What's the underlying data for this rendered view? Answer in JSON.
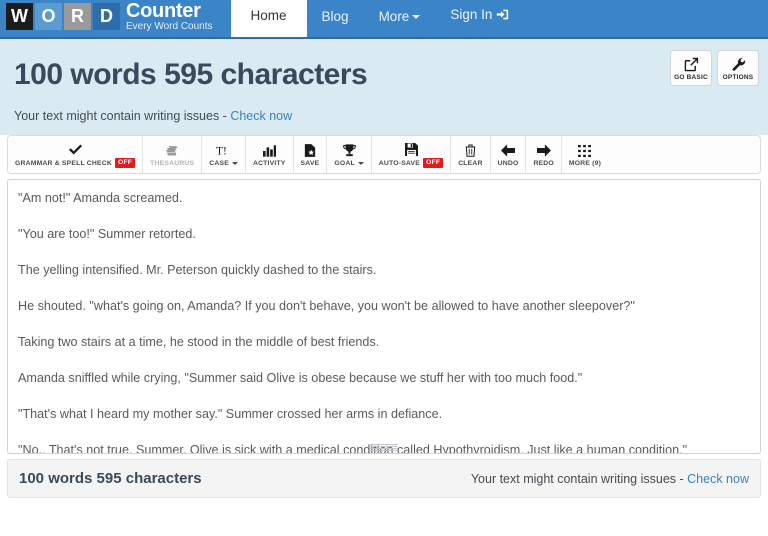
{
  "navbar": {
    "logo_letters": [
      "W",
      "O",
      "R",
      "D"
    ],
    "brand_title": "Counter",
    "brand_tagline": "Every Word Counts",
    "items": [
      {
        "label": "Home",
        "active": true
      },
      {
        "label": "Blog",
        "active": false
      },
      {
        "label": "More",
        "active": false,
        "caret": true
      },
      {
        "label": "Sign In",
        "active": false,
        "icon": "sign-in-icon"
      }
    ],
    "colors": {
      "bar": "#3b84c8",
      "bar_border": "#2f6da8"
    }
  },
  "banner": {
    "title": "100 words 595 characters",
    "notice_text": "Your text might contain writing issues - ",
    "notice_link": "Check now",
    "background": "#d9eaf2",
    "title_color": "#3a4a5c",
    "link_color": "#3a82c4",
    "actions": [
      {
        "label": "GO BASIC",
        "icon": "external-link-icon"
      },
      {
        "label": "OPTIONS",
        "icon": "wrench-icon"
      }
    ]
  },
  "toolbar": {
    "buttons": [
      {
        "label": "GRAMMAR & SPELL CHECK",
        "icon": "check-icon",
        "badge": "OFF",
        "caret": false,
        "muted": false
      },
      {
        "label": "THESAURUS",
        "icon": "book-icon",
        "badge": "",
        "caret": false,
        "muted": true
      },
      {
        "label": "CASE",
        "icon": "text-case-icon",
        "badge": "",
        "caret": true,
        "muted": false
      },
      {
        "label": "ACTIVITY",
        "icon": "bar-chart-icon",
        "badge": "",
        "caret": false,
        "muted": false
      },
      {
        "label": "SAVE",
        "icon": "save-document-icon",
        "badge": "",
        "caret": false,
        "muted": false
      },
      {
        "label": "GOAL",
        "icon": "trophy-icon",
        "badge": "",
        "caret": true,
        "muted": false
      },
      {
        "label": "AUTO-SAVE",
        "icon": "floppy-disk-icon",
        "badge": "OFF",
        "caret": false,
        "muted": false
      },
      {
        "label": "CLEAR",
        "icon": "trash-icon",
        "badge": "",
        "caret": false,
        "muted": false
      },
      {
        "label": "UNDO",
        "icon": "arrow-left-icon",
        "badge": "",
        "caret": false,
        "muted": false
      },
      {
        "label": "REDO",
        "icon": "arrow-right-icon",
        "badge": "",
        "caret": false,
        "muted": false
      },
      {
        "label": "MORE (9)",
        "icon": "grid-icon",
        "badge": "",
        "caret": false,
        "muted": false
      }
    ],
    "badge_color": "#e21b1b"
  },
  "editor": {
    "paragraphs": [
      "\"Am not!\" Amanda screamed.",
      "\"You are too!\" Summer retorted.",
      "The yelling intensified. Mr. Peterson quickly dashed to the stairs.",
      "He shouted. \"what's going on, Amanda? If you don't behave, you won't be allowed to have another sleepover?\"",
      "Taking two stairs at a time, he stood in the middle of best friends.",
      "Amanda sniffled while crying, \"Summer said Olive is obese because we stuff her with too much food.\"",
      "\"That's what I heard my mother say.\" Summer crossed her arms in defiance.",
      "\"No,. That's not true, Summer. Olive is sick with a medical condition called Hypothyroidism. Just like a human condition.\""
    ]
  },
  "footer": {
    "count": "100 words 595 characters",
    "notice_text": "Your text might contain writing issues - ",
    "notice_link": "Check now"
  }
}
